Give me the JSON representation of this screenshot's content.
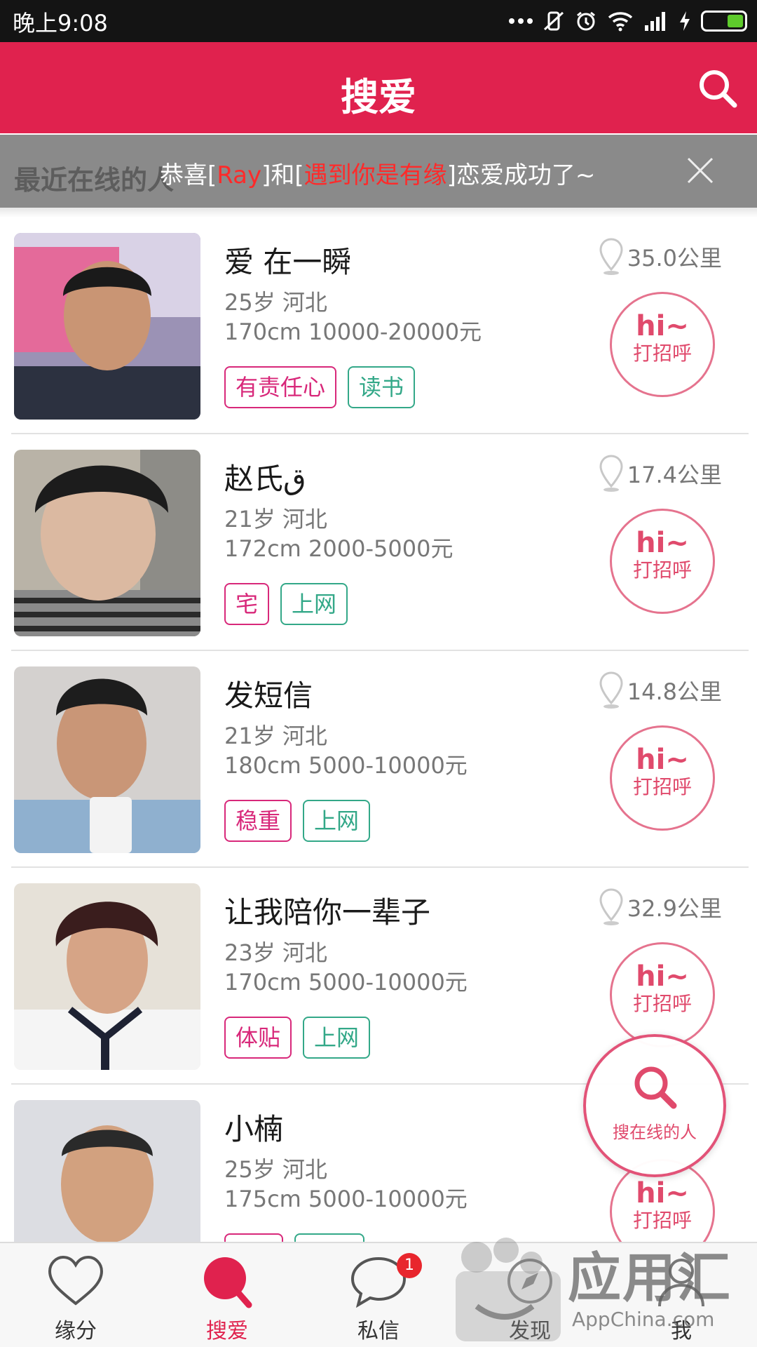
{
  "status_bar": {
    "time": "晚上9:08",
    "icons": [
      "more-dots-icon",
      "vibrate-off-icon",
      "alarm-icon",
      "wifi-icon",
      "signal-icon",
      "charging-icon",
      "battery-icon"
    ]
  },
  "header": {
    "title": "搜爱",
    "search_icon": "search-icon",
    "color": "#e0224e"
  },
  "banner": {
    "underlying_text": "最近在线的人",
    "prefix": "恭喜[",
    "name1": "Ray",
    "middle": "]和[",
    "name2": "遇到你是有缘",
    "suffix": "]恋爱成功了~",
    "close_icon": "close-icon"
  },
  "users": [
    {
      "name": "爱 在一瞬",
      "age_location": "25岁 河北",
      "height_income": "170cm 10000-20000元",
      "tags": [
        {
          "label": "有责任心",
          "color": "pink"
        },
        {
          "label": "读书",
          "color": "green"
        }
      ],
      "distance": "35.0公里",
      "hi_top": "hi~",
      "hi_bottom": "打招呼"
    },
    {
      "name": "赵氏ق",
      "age_location": "21岁 河北",
      "height_income": "172cm 2000-5000元",
      "tags": [
        {
          "label": "宅",
          "color": "pink"
        },
        {
          "label": "上网",
          "color": "green"
        }
      ],
      "distance": "17.4公里",
      "hi_top": "hi~",
      "hi_bottom": "打招呼"
    },
    {
      "name": "发短信",
      "age_location": "21岁 河北",
      "height_income": "180cm 5000-10000元",
      "tags": [
        {
          "label": "稳重",
          "color": "pink"
        },
        {
          "label": "上网",
          "color": "green"
        }
      ],
      "distance": "14.8公里",
      "hi_top": "hi~",
      "hi_bottom": "打招呼"
    },
    {
      "name": "让我陪你一辈子",
      "age_location": "23岁 河北",
      "height_income": "170cm 5000-10000元",
      "tags": [
        {
          "label": "体贴",
          "color": "pink"
        },
        {
          "label": "上网",
          "color": "green"
        }
      ],
      "distance": "32.9公里",
      "hi_top": "hi~",
      "hi_bottom": "打招呼"
    },
    {
      "name": "小楠",
      "age_location": "25岁 河北",
      "height_income": "175cm 5000-10000元",
      "tags": [
        {
          "label": "",
          "color": "pink"
        },
        {
          "label": "",
          "color": "green"
        }
      ],
      "distance": "",
      "hi_top": "hi~",
      "hi_bottom": "打招呼"
    }
  ],
  "fab": {
    "label": "搜在线的人",
    "icon": "search-icon"
  },
  "bottom_nav": {
    "items": [
      {
        "label": "缘分",
        "icon": "heart-icon",
        "active": false
      },
      {
        "label": "搜爱",
        "icon": "search-icon",
        "active": true
      },
      {
        "label": "私信",
        "icon": "chat-bubble-icon",
        "active": false,
        "badge": "1"
      },
      {
        "label": "发现",
        "icon": "discover-icon",
        "active": false
      },
      {
        "label": "我",
        "icon": "profile-icon",
        "active": false
      }
    ]
  },
  "watermark": {
    "title": "应用汇",
    "subtitle": "AppChina.com"
  }
}
